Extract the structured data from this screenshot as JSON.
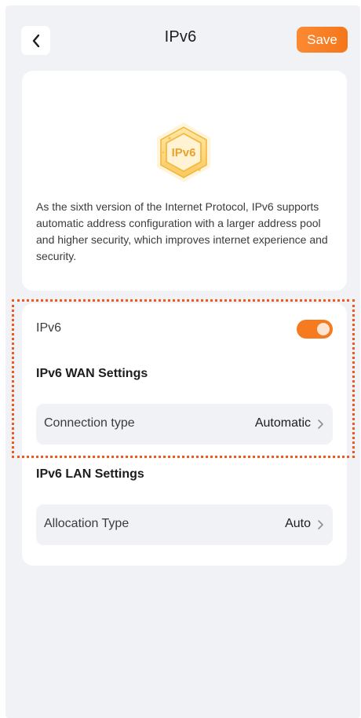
{
  "header": {
    "title": "IPv6",
    "save_label": "Save"
  },
  "intro": {
    "logo_text": "IPv6",
    "description": "As the sixth version of the Internet Protocol, IPv6 supports automatic address configuration with a larger address pool and higher security, which improves internet experience and security."
  },
  "settings": {
    "ipv6_toggle": {
      "label": "IPv6",
      "enabled": true
    },
    "wan": {
      "title": "IPv6 WAN Settings",
      "connection_type_label": "Connection type",
      "connection_type_value": "Automatic"
    },
    "lan": {
      "title": "IPv6 LAN Settings",
      "allocation_type_label": "Allocation Type",
      "allocation_type_value": "Auto"
    }
  },
  "colors": {
    "accent": "#f57a20",
    "highlight": "#f0581e",
    "background": "#f1f2f5"
  }
}
